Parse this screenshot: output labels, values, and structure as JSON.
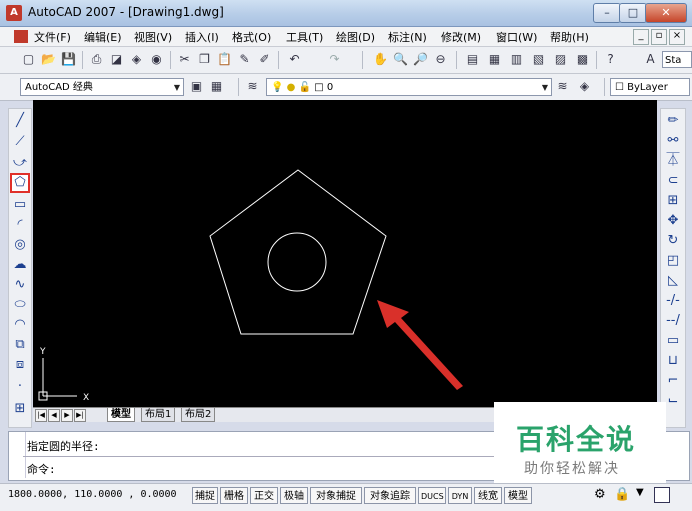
{
  "window": {
    "title": "AutoCAD 2007 - [Drawing1.dwg]",
    "minimize": "–",
    "maximize": "□",
    "close": "✕"
  },
  "menu": {
    "items": [
      "文件(F)",
      "编辑(E)",
      "视图(V)",
      "插入(I)",
      "格式(O)",
      "工具(T)",
      "绘图(D)",
      "标注(N)",
      "修改(M)",
      "窗口(W)",
      "帮助(H)"
    ],
    "doc_controls": [
      "_",
      "▫",
      "×"
    ]
  },
  "toolbar": {
    "style_box": "Sta"
  },
  "workspace": {
    "name": "AutoCAD 经典",
    "layer": "0",
    "linetype": "ByLayer"
  },
  "drawing_tabs": [
    "模型",
    "布局1",
    "布局2"
  ],
  "ucs": {
    "x_label": "X",
    "y_label": "Y"
  },
  "command": {
    "line1": "指定圆的半径:",
    "line2": "命令:"
  },
  "status": {
    "coords": "1800.0000, 110.0000 , 0.0000",
    "buttons": [
      "捕捉",
      "栅格",
      "正交",
      "极轴",
      "对象捕捉",
      "对象追踪",
      "DUCS",
      "DYN",
      "线宽",
      "模型"
    ]
  },
  "watermark": {
    "main": "百科全说",
    "sub": "助你轻松解决"
  },
  "colors": {
    "highlight": "#e0302a",
    "arrow": "#d9302a",
    "canvas": "#000000",
    "geometry": "#ffffff",
    "brand": "#2aa36b"
  }
}
